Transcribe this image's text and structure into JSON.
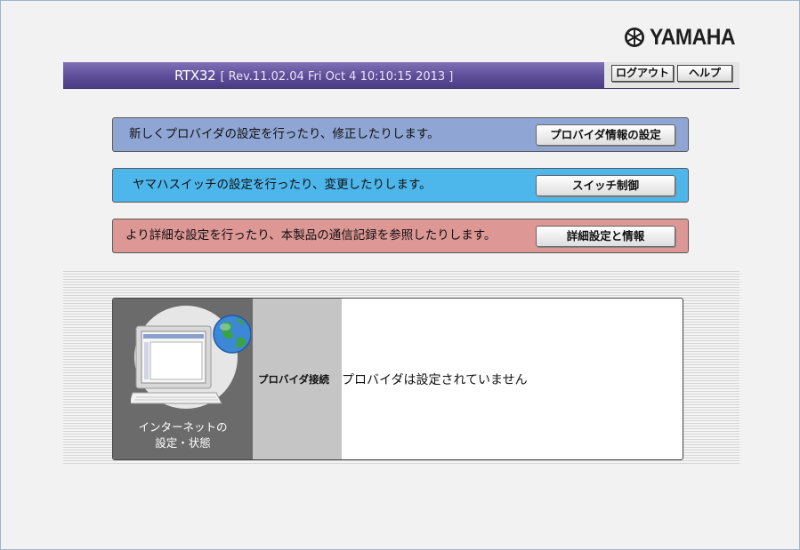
{
  "brand": {
    "logo_text": "YAMAHA",
    "logo_icon": "yamaha-tuning-fork-emblem"
  },
  "header": {
    "model": "RTX32",
    "revision": "[ Rev.11.02.04 Fri Oct 4 10:10:15 2013 ]",
    "logout_label": "ログアウト",
    "help_label": "ヘルプ"
  },
  "actions": [
    {
      "description": "新しくプロバイダの設定を行ったり、修正したりします。",
      "button_label": "プロバイダ情報の設定",
      "color": "#8fa6d4"
    },
    {
      "description": "ヤマハスイッチの設定を行ったり、変更したりします。",
      "button_label": "スイッチ制御",
      "color": "#4db6eb"
    },
    {
      "description": "より詳細な設定を行ったり、本製品の通信記録を参照したりします。",
      "button_label": "詳細設定と情報",
      "color": "#dd9794"
    }
  ],
  "status_panel": {
    "icon": "computer-globe-icon",
    "caption_line1": "インターネットの",
    "caption_line2": "設定・状態",
    "label": "プロバイダ接続",
    "value": "プロバイダは設定されていません"
  },
  "colors": {
    "header_purple": "#5d4d98",
    "panel_blue": "#8fa6d4",
    "panel_cyan": "#4db6eb",
    "panel_pink": "#dd9794"
  }
}
